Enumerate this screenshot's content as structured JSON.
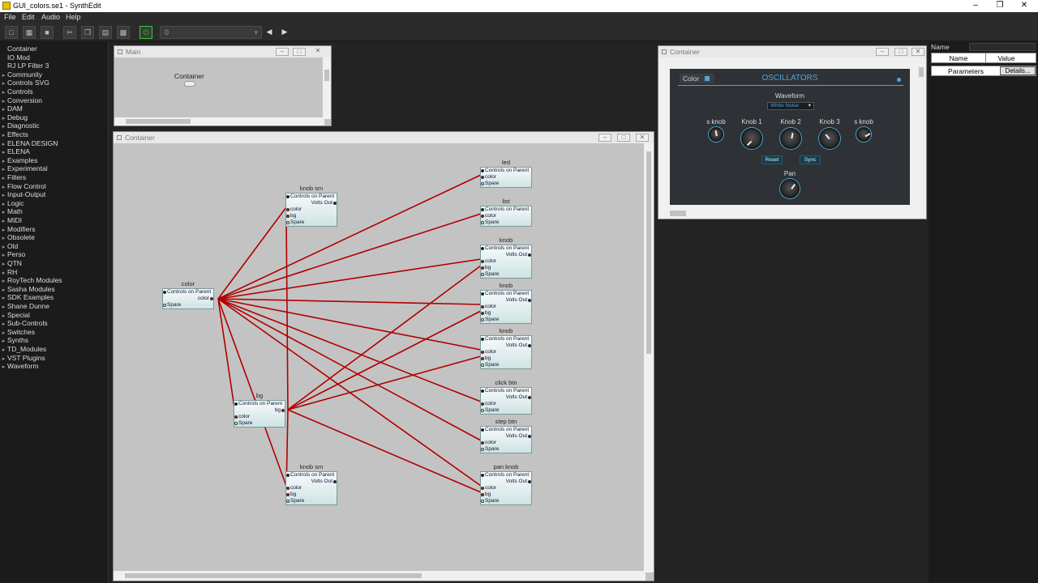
{
  "window": {
    "title": "GUI_colors.se1 - SynthEdit"
  },
  "menu": [
    "File",
    "Edit",
    "Audio",
    "Help"
  ],
  "toolbar": {
    "combo_value": "0"
  },
  "sidebar": {
    "items": [
      {
        "label": "Container",
        "expandable": false
      },
      {
        "label": "IO Mod",
        "expandable": false
      },
      {
        "label": "RJ LP Filter 3",
        "expandable": false
      },
      {
        "label": "Community",
        "expandable": true
      },
      {
        "label": "Controls SVG",
        "expandable": true
      },
      {
        "label": "Controls",
        "expandable": true
      },
      {
        "label": "Conversion",
        "expandable": true
      },
      {
        "label": "DAM",
        "expandable": true
      },
      {
        "label": "Debug",
        "expandable": true
      },
      {
        "label": "Diagnostic",
        "expandable": true
      },
      {
        "label": "Effects",
        "expandable": true
      },
      {
        "label": "ELENA DESIGN",
        "expandable": true
      },
      {
        "label": "ELENA",
        "expandable": true
      },
      {
        "label": "Examples",
        "expandable": true
      },
      {
        "label": "Experimental",
        "expandable": true
      },
      {
        "label": "Filters",
        "expandable": true
      },
      {
        "label": "Flow Control",
        "expandable": true
      },
      {
        "label": "Input-Output",
        "expandable": true
      },
      {
        "label": "Logic",
        "expandable": true
      },
      {
        "label": "Math",
        "expandable": true
      },
      {
        "label": "MIDI",
        "expandable": true
      },
      {
        "label": "Modifiers",
        "expandable": true
      },
      {
        "label": "Obsolete",
        "expandable": true
      },
      {
        "label": "Old",
        "expandable": true
      },
      {
        "label": "Perso",
        "expandable": true
      },
      {
        "label": "QTN",
        "expandable": true
      },
      {
        "label": "RH",
        "expandable": true
      },
      {
        "label": "RoyTech Modules",
        "expandable": true
      },
      {
        "label": "Sasha Modules",
        "expandable": true
      },
      {
        "label": "SDK Examples",
        "expandable": true
      },
      {
        "label": "Shane Dunne",
        "expandable": true
      },
      {
        "label": "Special",
        "expandable": true
      },
      {
        "label": "Sub-Controls",
        "expandable": true
      },
      {
        "label": "Switches",
        "expandable": true
      },
      {
        "label": "Synths",
        "expandable": true
      },
      {
        "label": "TD_Modules",
        "expandable": true
      },
      {
        "label": "VST Plugins",
        "expandable": true
      },
      {
        "label": "Waveform",
        "expandable": true
      }
    ]
  },
  "main_window": {
    "title": "Main",
    "container_label": "Container"
  },
  "container_window": {
    "title": "Container",
    "pin_labels": {
      "controls_on_parent": "Controls on Parent",
      "volts_out": "Volts Out",
      "color": "color",
      "bg": "bg",
      "spare": "Spare"
    },
    "modules": {
      "color_src": "color",
      "bg_src": "bg",
      "knob_sm_top": "knob sm",
      "knob_sm_bottom": "knob sm",
      "led": "led",
      "list": "list",
      "knob1": "knob",
      "knob2": "knob",
      "knob3": "knob",
      "click_btn": "click btn",
      "step_btn": "step btn",
      "pan_knob": "pan knob"
    },
    "wire_color": "#b00000"
  },
  "panel_window": {
    "title": "Container",
    "color_label": "Color",
    "heading": "OSCILLATORS",
    "waveform_label": "Waveform",
    "waveform_value": "White Noise",
    "knobs": [
      "s knob",
      "Knob 1",
      "Knob 2",
      "Knob 3",
      "s knob"
    ],
    "reset_label": "Reset",
    "sync_label": "Sync",
    "pan_label": "Pan",
    "accent": "#4aa8d8"
  },
  "properties": {
    "name_label": "Name",
    "col_name": "Name",
    "col_value": "Value",
    "parameters_label": "Parameters",
    "details_label": "Details..."
  }
}
